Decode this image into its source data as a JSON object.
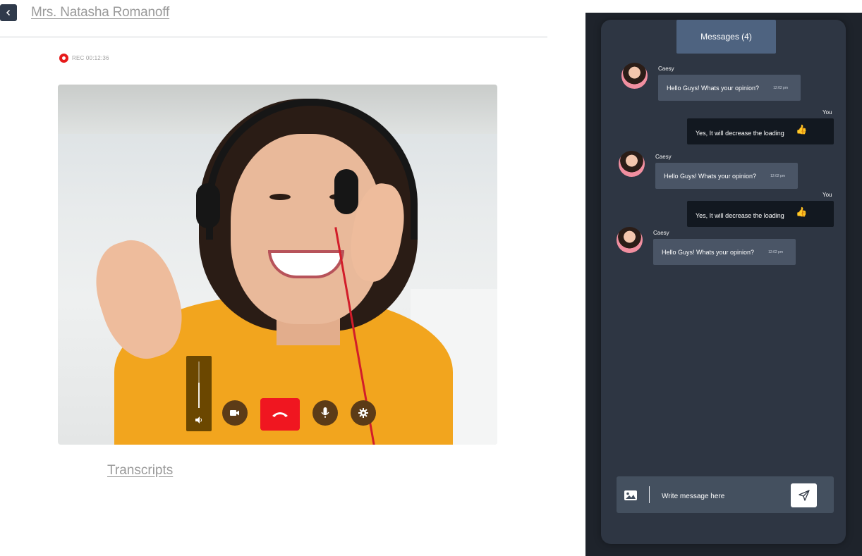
{
  "header": {
    "contact_name": "Mrs. Natasha Romanoff"
  },
  "recording": {
    "label": "REC 00:12:36"
  },
  "video_controls": {
    "volume_level": 0.55,
    "buttons": [
      "camera-icon",
      "end-call-icon",
      "microphone-icon",
      "settings-icon"
    ],
    "end_call_color": "#f01620"
  },
  "transcripts": {
    "label": "Transcripts"
  },
  "chat": {
    "tab_label": "Messages (4)",
    "messages": [
      {
        "sender": "Caesy",
        "text": "Hello Guys! Whats your opinion?",
        "time": "12:02 pm",
        "direction": "in"
      },
      {
        "sender": "You",
        "text": "Yes, It will decrease the loading",
        "emoji": "👍",
        "direction": "out"
      },
      {
        "sender": "Caesy",
        "text": "Hello Guys! Whats your opinion?",
        "time": "12:02 pm",
        "direction": "in"
      },
      {
        "sender": "You",
        "text": "Yes, It will decrease the loading",
        "emoji": "👍",
        "direction": "out"
      },
      {
        "sender": "Caesy",
        "text": "Hello Guys! Whats your opinion?",
        "time": "12:02 pm",
        "direction": "in"
      }
    ],
    "composer": {
      "placeholder": "Write message here"
    }
  },
  "colors": {
    "panel_bg": "#1e232b",
    "card_bg": "#2e3643",
    "tab_bg": "#4e6380",
    "incoming_bubble": "#4a5566",
    "outgoing_bubble": "#121820",
    "header_button": "#2f3a4b"
  }
}
